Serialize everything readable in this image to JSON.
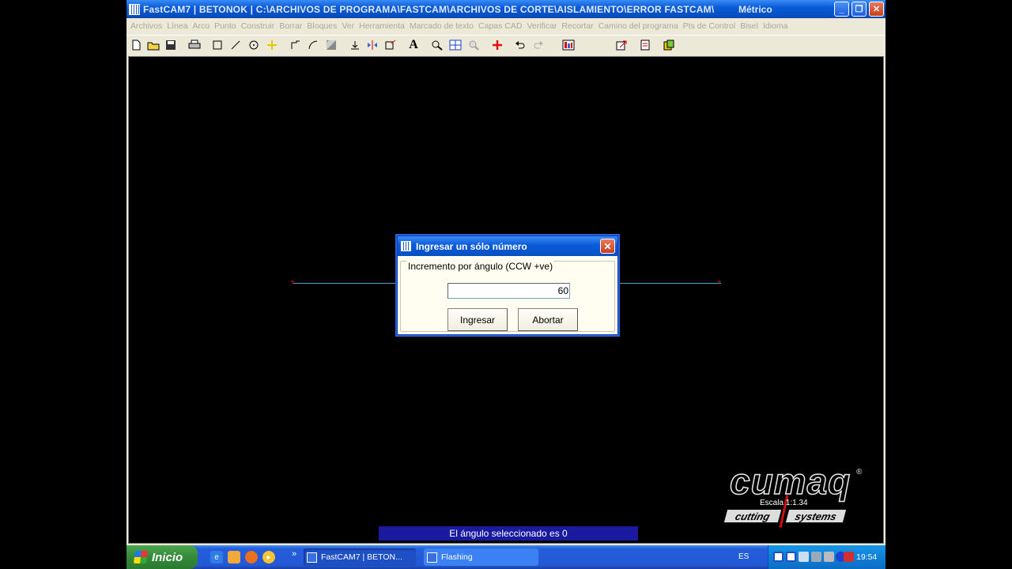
{
  "window": {
    "title": "FastCAM7  |  BETONOK  |  C:\\ARCHIVOS DE PROGRAMA\\FASTCAM\\ARCHIVOS DE CORTE\\AISLAMIENTO\\ERROR FASTCAM\\",
    "units": "Métrico",
    "minimize": "_",
    "restore": "❐",
    "close": "✕"
  },
  "menu": [
    "Archivos",
    "Línea",
    "Arco",
    "Punto",
    "Construir",
    "Borrar",
    "Bloques",
    "Ver",
    "Herramienta",
    "Marcado de texto",
    "Capas CAD",
    "Verificar",
    "Recortar",
    "Camino del programa",
    "Pts de Control",
    "Bisel",
    "Idioma"
  ],
  "toolbar_icons": [
    "new-file",
    "open-folder",
    "save",
    "print",
    "rectangle",
    "line",
    "circle",
    "point",
    "step",
    "curve",
    "fillet",
    "move",
    "mirror",
    "scale",
    "text",
    "zoom-window",
    "zoom-fit",
    "zoom-out",
    "add-point",
    "undo",
    "redo",
    "nest",
    "export",
    "import",
    "cut-path"
  ],
  "toolbar_text_icon": "A",
  "dialog": {
    "title": "Ingresar un sólo número",
    "close": "✕",
    "group_label": "Incremento por ángulo (CCW +ve)",
    "value": "60",
    "ok_label": "Ingresar",
    "cancel_label": "Abortar"
  },
  "status_message": "El ángulo seleccionado es 0",
  "logo": {
    "word": "cumaq",
    "reg": "®",
    "strip_left": "cutting",
    "strip_right": "systems"
  },
  "scale_label": "Escala   1:1.34",
  "taskbar": {
    "start_label": "Inicio",
    "overflow": "»",
    "tasks": [
      "FastCAM7  |  BETON...",
      "Flashing"
    ],
    "language": "ES",
    "clock": "19:54"
  }
}
